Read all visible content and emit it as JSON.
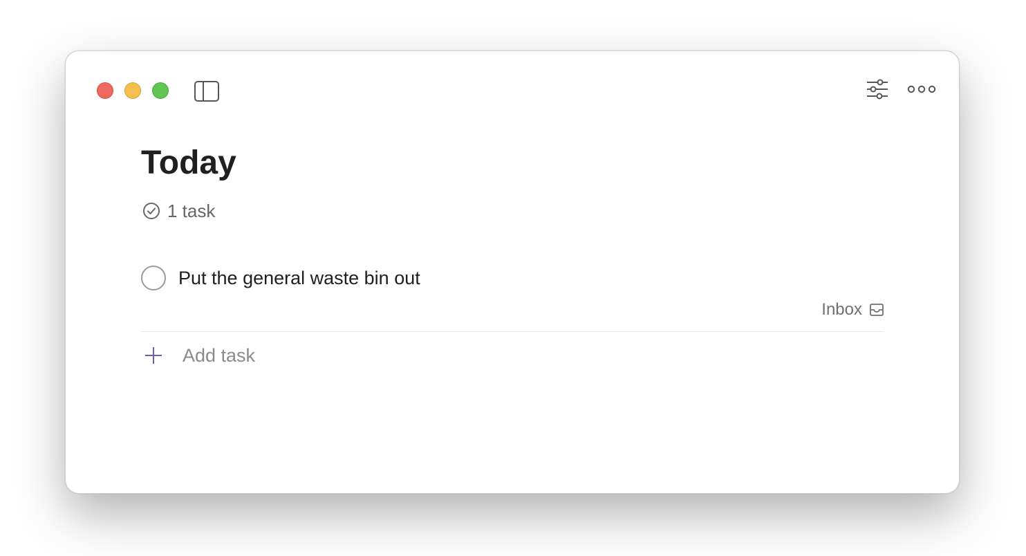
{
  "window": {
    "traffic_lights": [
      "close",
      "minimize",
      "maximize"
    ],
    "colors": {
      "close": "#ec6a5e",
      "minimize": "#f4bf4f",
      "maximize": "#61c554",
      "accent": "#6b5fb5"
    }
  },
  "toolbar": {
    "left_icon": "sidebar-toggle-icon",
    "right_icons": [
      "sliders-icon",
      "more-horizontal-icon"
    ]
  },
  "page": {
    "title": "Today",
    "task_count_label": "1 task",
    "task_count_icon": "check-circle-icon"
  },
  "tasks": [
    {
      "content": "Put the general waste bin out",
      "project": "Inbox",
      "project_icon": "inbox-icon",
      "completed": false
    }
  ],
  "add_task": {
    "label": "Add task",
    "icon": "plus-icon"
  }
}
